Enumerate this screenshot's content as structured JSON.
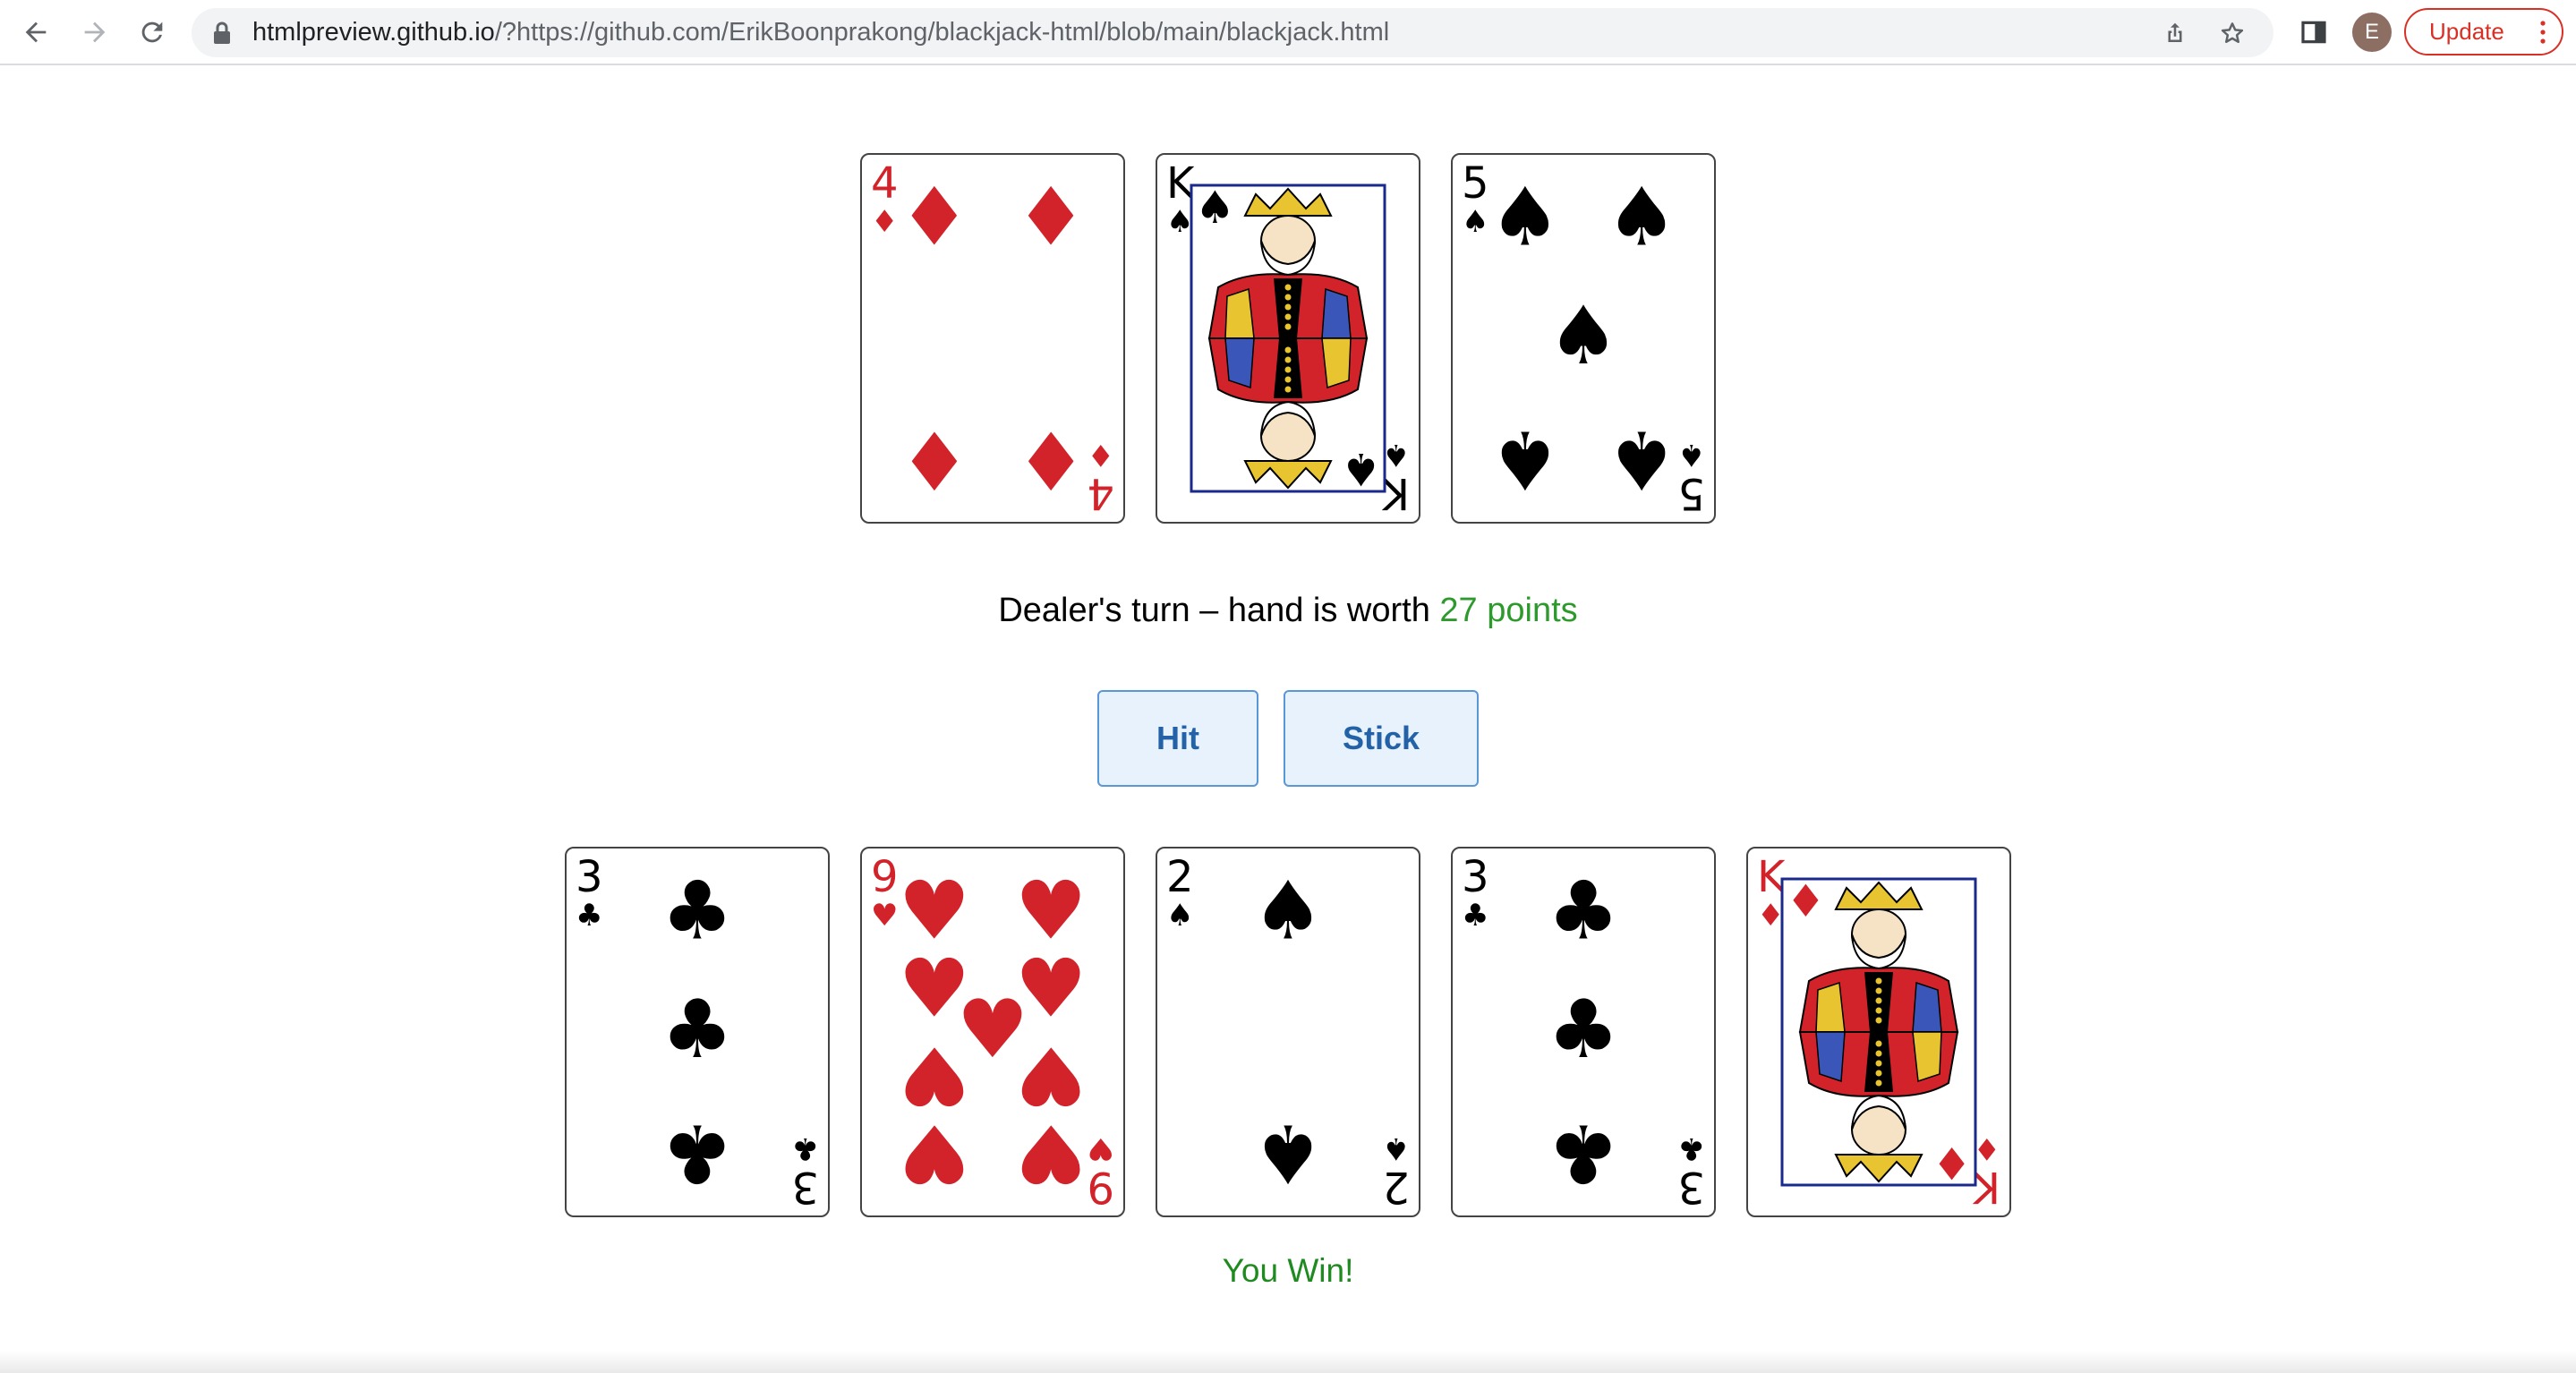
{
  "browser": {
    "url_host": "htmlpreview.github.io",
    "url_rest": "/?https://github.com/ErikBoonprakong/blackjack-html/blob/main/blackjack.html",
    "profile_initial": "E",
    "update_label": "Update",
    "icons": [
      "back-icon",
      "forward-icon",
      "reload-icon",
      "lock-icon",
      "share-icon",
      "star-icon",
      "side-panel-icon",
      "more-vert-icon"
    ]
  },
  "dealer": {
    "cards": [
      {
        "rank": "4",
        "suit": "diamonds",
        "symbol": "♦",
        "color": "#d2232a"
      },
      {
        "rank": "K",
        "suit": "spades",
        "symbol": "♠",
        "color": "#000000"
      },
      {
        "rank": "5",
        "suit": "spades",
        "symbol": "♠",
        "color": "#000000"
      }
    ],
    "status_prefix": "Dealer's turn – hand is worth ",
    "points": "27 points"
  },
  "controls": {
    "hit_label": "Hit",
    "stick_label": "Stick"
  },
  "player": {
    "cards": [
      {
        "rank": "3",
        "suit": "clubs",
        "symbol": "♣",
        "color": "#000000"
      },
      {
        "rank": "9",
        "suit": "hearts",
        "symbol": "♥",
        "color": "#d2232a"
      },
      {
        "rank": "2",
        "suit": "spades",
        "symbol": "♠",
        "color": "#000000"
      },
      {
        "rank": "3",
        "suit": "clubs",
        "symbol": "♣",
        "color": "#000000"
      },
      {
        "rank": "K",
        "suit": "diamonds",
        "symbol": "♦",
        "color": "#d2232a"
      }
    ]
  },
  "result": "You Win!",
  "colors": {
    "points_green": "#2e9a2e",
    "result_green": "#1f8a1f",
    "button_bg": "#e8f2fd",
    "button_border": "#5a97d6",
    "button_text": "#2462a8",
    "update_red": "#d93025"
  }
}
